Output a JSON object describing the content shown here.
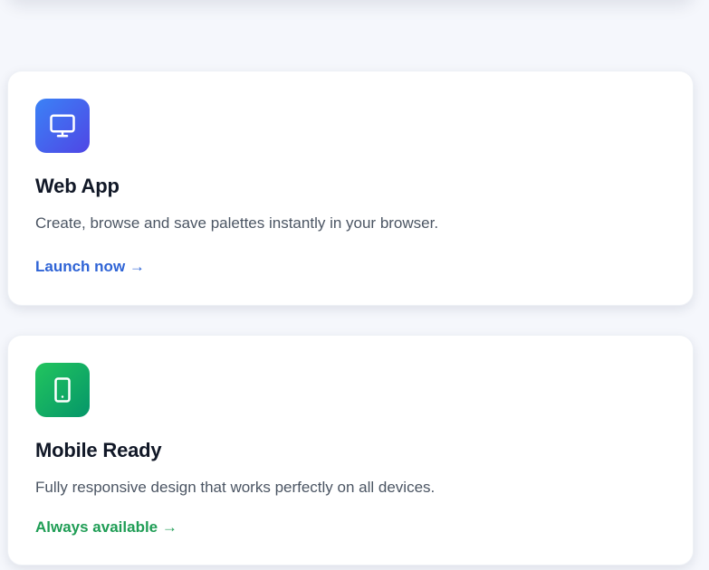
{
  "cards": [
    {
      "icon": "monitor-icon",
      "title": "Web App",
      "description": "Create, browse and save palettes instantly in your browser.",
      "link": "Launch now →",
      "accent": "#2f64d6",
      "gradient": [
        "#3b82f6",
        "#4f46e5"
      ]
    },
    {
      "icon": "smartphone-icon",
      "title": "Mobile Ready",
      "description": "Fully responsive design that works perfectly on all devices.",
      "link": "Always available →",
      "accent": "#1f9d55",
      "gradient": [
        "#22c55e",
        "#059669"
      ]
    }
  ],
  "colors": {
    "background": "#f5f7fc",
    "card": "#ffffff",
    "title": "#111827",
    "text": "#4b5563"
  }
}
